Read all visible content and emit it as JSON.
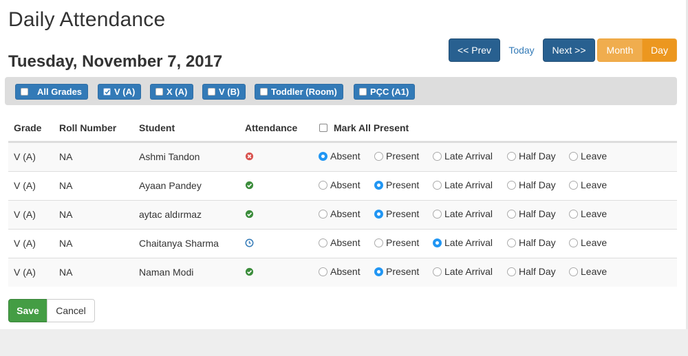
{
  "page": {
    "title": "Daily Attendance",
    "date": "Tuesday, November 7, 2017"
  },
  "nav": {
    "prev_label": "<< Prev",
    "today_label": "Today",
    "next_label": "Next >>",
    "month_label": "Month",
    "day_label": "Day",
    "active_view": "Day"
  },
  "filters": [
    {
      "label": "All Grades",
      "checked": false
    },
    {
      "label": "V (A)",
      "checked": true
    },
    {
      "label": "X (A)",
      "checked": false
    },
    {
      "label": "V (B)",
      "checked": false
    },
    {
      "label": "Toddler (Room)",
      "checked": false
    },
    {
      "label": "PÇC (A1)",
      "checked": false
    }
  ],
  "table": {
    "headers": {
      "grade": "Grade",
      "roll": "Roll Number",
      "student": "Student",
      "attendance": "Attendance",
      "mark_all": "Mark All Present"
    },
    "options": [
      "Absent",
      "Present",
      "Late Arrival",
      "Half Day",
      "Leave"
    ],
    "rows": [
      {
        "grade": "V (A)",
        "roll": "NA",
        "student": "Ashmi Tandon",
        "status_icon": "x-circle-icon",
        "selected": "Absent"
      },
      {
        "grade": "V (A)",
        "roll": "NA",
        "student": "Ayaan Pandey",
        "status_icon": "check-circle-icon",
        "selected": "Present"
      },
      {
        "grade": "V (A)",
        "roll": "NA",
        "student": "aytac aldırmaz",
        "status_icon": "check-circle-icon",
        "selected": "Present"
      },
      {
        "grade": "V (A)",
        "roll": "NA",
        "student": "Chaitanya Sharma",
        "status_icon": "clock-icon",
        "selected": "Late Arrival"
      },
      {
        "grade": "V (A)",
        "roll": "NA",
        "student": "Naman Modi",
        "status_icon": "check-circle-icon",
        "selected": "Present"
      }
    ]
  },
  "footer": {
    "save_label": "Save",
    "cancel_label": "Cancel"
  },
  "colors": {
    "primary": "#337ab7",
    "nav_dark": "#286090",
    "warning": "#f0ad4e",
    "success": "#449d44",
    "radio_on": "#2196f3",
    "absent_icon": "#d9534f",
    "present_icon": "#3c8d3c",
    "late_icon": "#337ab7"
  }
}
